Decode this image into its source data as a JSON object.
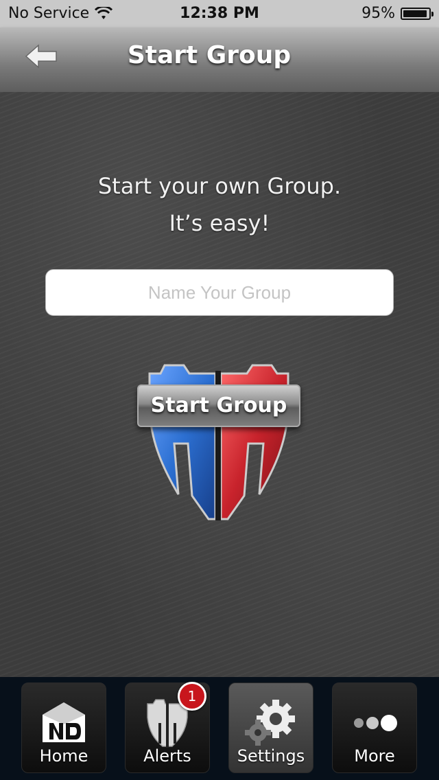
{
  "status_bar": {
    "carrier": "No Service",
    "time": "12:38 PM",
    "battery_percent": "95%",
    "battery_level": 0.95,
    "wifi_icon": "wifi-icon"
  },
  "nav": {
    "title": "Start Group",
    "back_icon": "back-arrow-icon"
  },
  "main": {
    "headline_line1": "Start your own Group.",
    "headline_line2": "It’s easy!",
    "group_name_placeholder": "Name Your Group",
    "group_name_value": "",
    "start_button_label": "Start Group",
    "shield_colors": {
      "left": "#2c6fd1",
      "right": "#c8232c"
    }
  },
  "tabbar": {
    "tabs": [
      {
        "label": "Home",
        "icon": "home-icon"
      },
      {
        "label": "Alerts",
        "icon": "shield-icon",
        "badge": "1"
      },
      {
        "label": "Settings",
        "icon": "gear-icon",
        "active": true
      },
      {
        "label": "More",
        "icon": "more-dots-icon"
      }
    ]
  }
}
